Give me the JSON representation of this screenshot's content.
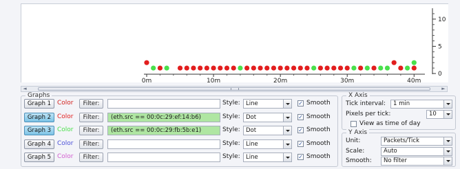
{
  "chart_data": {
    "type": "scatter",
    "x_unit": "minutes",
    "xlim": [
      0,
      41
    ],
    "ylim": [
      0,
      12
    ],
    "x_ticks": [
      0,
      10,
      20,
      30,
      40
    ],
    "x_tick_labels": [
      "0m",
      "10m",
      "20m",
      "30m",
      "40m"
    ],
    "y_ticks": [
      0,
      5,
      10
    ],
    "y_tick_labels": [
      "0",
      "5",
      "10"
    ],
    "y_axis_side": "right",
    "grid": false,
    "colors": {
      "red": "#e21e1e",
      "green": "#49e04b"
    },
    "series": [
      {
        "color": "#e21e1e",
        "points": [
          [
            0,
            2
          ],
          [
            2,
            1
          ],
          [
            5,
            1
          ],
          [
            6,
            1
          ],
          [
            7,
            1
          ],
          [
            8,
            1
          ],
          [
            9,
            1
          ],
          [
            10,
            1
          ],
          [
            11,
            1
          ],
          [
            12,
            1
          ],
          [
            13,
            1
          ],
          [
            15,
            1
          ],
          [
            16,
            1
          ],
          [
            17,
            1
          ],
          [
            18,
            1
          ],
          [
            19,
            1
          ],
          [
            20,
            1
          ],
          [
            21,
            1
          ],
          [
            22,
            1
          ],
          [
            23,
            1
          ],
          [
            24,
            1
          ],
          [
            26,
            1
          ],
          [
            27,
            1
          ],
          [
            28,
            1
          ],
          [
            29,
            1
          ],
          [
            30,
            1
          ],
          [
            32,
            1
          ],
          [
            34,
            1
          ],
          [
            37,
            2
          ],
          [
            38,
            1
          ],
          [
            40,
            1
          ]
        ]
      },
      {
        "color": "#49e04b",
        "points": [
          [
            1,
            1
          ],
          [
            3,
            1
          ],
          [
            14,
            1
          ],
          [
            25,
            1
          ],
          [
            31,
            1
          ],
          [
            33,
            1
          ],
          [
            35,
            1
          ],
          [
            36,
            1
          ],
          [
            39,
            1
          ],
          [
            40,
            2
          ]
        ]
      }
    ]
  },
  "graphs": {
    "title": "Graphs",
    "color_label": "Color",
    "filter_label": "Filter:",
    "style_label": "Style:",
    "smooth_label": "Smooth",
    "rows": [
      {
        "name": "Graph 1",
        "color": "#d3211d",
        "active": false,
        "filter": "",
        "style": "Line",
        "smooth": true
      },
      {
        "name": "Graph 2",
        "color": "#e21e1e",
        "active": true,
        "filter": "(eth.src == 00:0c:29:ef:14:b6)",
        "style": "Dot",
        "smooth": true
      },
      {
        "name": "Graph 3",
        "color": "#49e04b",
        "active": true,
        "filter": "(eth.src == 00:0c:29:fb:5b:e1)",
        "style": "Dot",
        "smooth": true
      },
      {
        "name": "Graph 4",
        "color": "#4a4fd8",
        "active": false,
        "filter": "",
        "style": "Line",
        "smooth": true
      },
      {
        "name": "Graph 5",
        "color": "#d25ccf",
        "active": false,
        "filter": "",
        "style": "Line",
        "smooth": true
      }
    ]
  },
  "x_axis": {
    "title": "X Axis",
    "tick_interval_label": "Tick interval:",
    "tick_interval_value": "1 min",
    "pixels_per_tick_label": "Pixels per tick:",
    "pixels_per_tick_value": "10",
    "view_as_time_label": "View as time of day"
  },
  "y_axis": {
    "title": "Y Axis",
    "unit_label": "Unit:",
    "unit_value": "Packets/Tick",
    "scale_label": "Scale:",
    "scale_value": "Auto",
    "smooth_label": "Smooth:",
    "smooth_value": "No filter"
  },
  "scrollbar": {
    "left_arrow": "◄",
    "right_arrow": "►"
  }
}
